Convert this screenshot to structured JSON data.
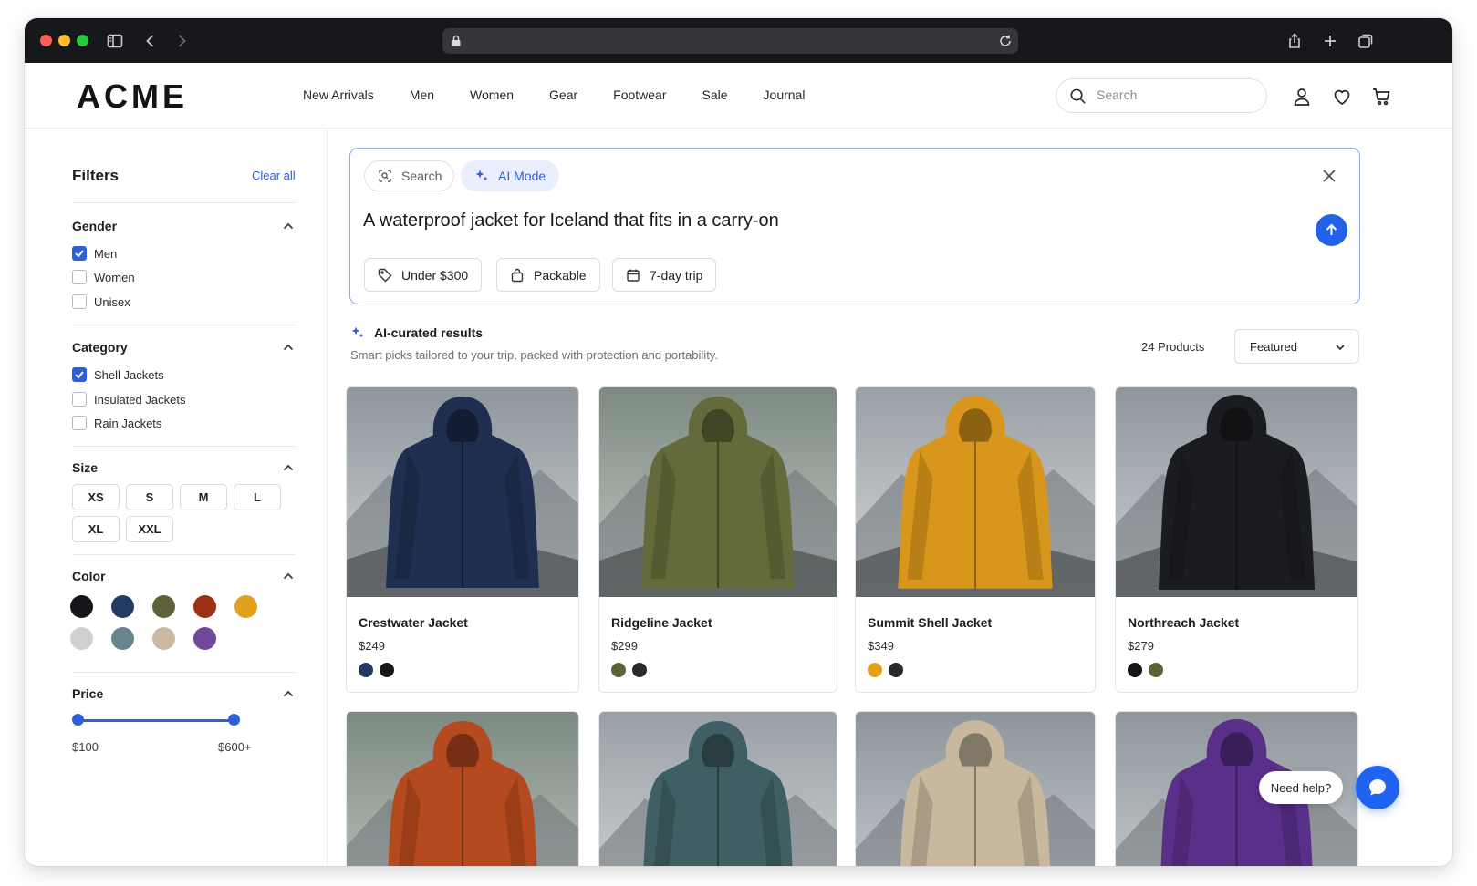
{
  "browser": {
    "traffic_lights": [
      "#ff5f57",
      "#febc2e",
      "#28c840"
    ],
    "icons": [
      "sidebar-icon",
      "back-icon",
      "forward-icon",
      "lock-icon",
      "reload-icon",
      "share-icon",
      "new-tab-icon",
      "tabs-icon"
    ]
  },
  "header": {
    "logo": "ACME",
    "nav": [
      "New Arrivals",
      "Men",
      "Women",
      "Gear",
      "Footwear",
      "Sale",
      "Journal"
    ],
    "search_placeholder": "Search",
    "icons": [
      "account-icon",
      "wishlist-icon",
      "cart-icon"
    ]
  },
  "sidebar": {
    "title": "Filters",
    "clear_all": "Clear all",
    "gender": {
      "title": "Gender",
      "options": [
        {
          "label": "Men",
          "checked": true
        },
        {
          "label": "Women",
          "checked": false
        },
        {
          "label": "Unisex",
          "checked": false
        }
      ]
    },
    "category": {
      "title": "Category",
      "options": [
        {
          "label": "Shell Jackets",
          "checked": true
        },
        {
          "label": "Insulated Jackets",
          "checked": false
        },
        {
          "label": "Rain Jackets",
          "checked": false
        }
      ]
    },
    "size": {
      "title": "Size",
      "options": [
        "XS",
        "S",
        "M",
        "L",
        "XL",
        "XXL"
      ]
    },
    "color": {
      "title": "Color",
      "swatches": [
        "#15161a",
        "#233b63",
        "#5f6238",
        "#9c2f16",
        "#e0a21c",
        "#cfd0d2",
        "#67858c",
        "#c9b9a0",
        "#6f4a9b"
      ]
    },
    "price": {
      "title": "Price",
      "min_label": "$100",
      "max_label": "$600+"
    }
  },
  "ai_search": {
    "tab_search": "Search",
    "tab_ai": "AI Mode",
    "query": "A waterproof jacket for Iceland that fits in a carry-on",
    "chips": [
      "Under $300",
      "Packable",
      "7-day trip"
    ]
  },
  "results": {
    "title": "AI-curated results",
    "subtitle": "Smart picks tailored to your trip, packed with protection and portability.",
    "count": "24 Products",
    "sort": "Featured"
  },
  "products": [
    {
      "name": "Crestwater Jacket",
      "price": "$249",
      "colors": [
        "#233b63",
        "#15161a"
      ],
      "jacket": "#1e2f52"
    },
    {
      "name": "Ridgeline Jacket",
      "price": "$299",
      "colors": [
        "#5f6238",
        "#2a2a2a"
      ],
      "jacket": "#646a3a"
    },
    {
      "name": "Summit Shell Jacket",
      "price": "$349",
      "colors": [
        "#e0a21c",
        "#2a2a2a"
      ],
      "jacket": "#d9961c"
    },
    {
      "name": "Northreach Jacket",
      "price": "$279",
      "colors": [
        "#15161a",
        "#5f6238"
      ],
      "jacket": "#1b1c1f"
    }
  ],
  "products_row2_colors": [
    "#b5491f",
    "#3f5f64",
    "#c7b89e",
    "#5a2f8a"
  ],
  "help": {
    "label": "Need help?"
  }
}
